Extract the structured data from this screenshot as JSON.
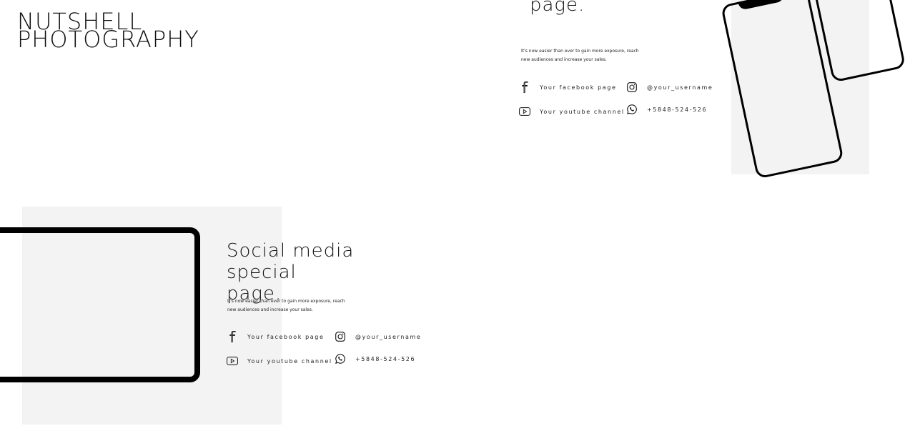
{
  "brand": {
    "line1": "NUTSHELL",
    "line2": "PHOTOGRAPHY"
  },
  "top_slide": {
    "heading_fragment": "page.",
    "description_line1": "It's now easier than ever to gain more exposure, reach",
    "description_line2": "new audiences and increase your sales.",
    "facebook": "Your facebook page",
    "youtube": "Your youtube channel",
    "instagram": "@your_username",
    "phone": "+5848-524-526"
  },
  "bottom_slide": {
    "heading_line1": "Social media special",
    "heading_line2": "page.",
    "description_line1": "It's now easier than ever to gain more exposure, reach",
    "description_line2": "new audiences and increase your sales.",
    "facebook": "Your facebook page",
    "youtube": "Your youtube channel",
    "instagram": "@your_username",
    "phone": "+5848-524-526"
  },
  "icons": {
    "facebook": "facebook-icon",
    "youtube": "youtube-icon",
    "instagram": "instagram-icon",
    "whatsapp": "whatsapp-icon"
  },
  "colors": {
    "panel_bg": "#f3f3f3",
    "text": "#111111",
    "device_frame": "#000000"
  }
}
